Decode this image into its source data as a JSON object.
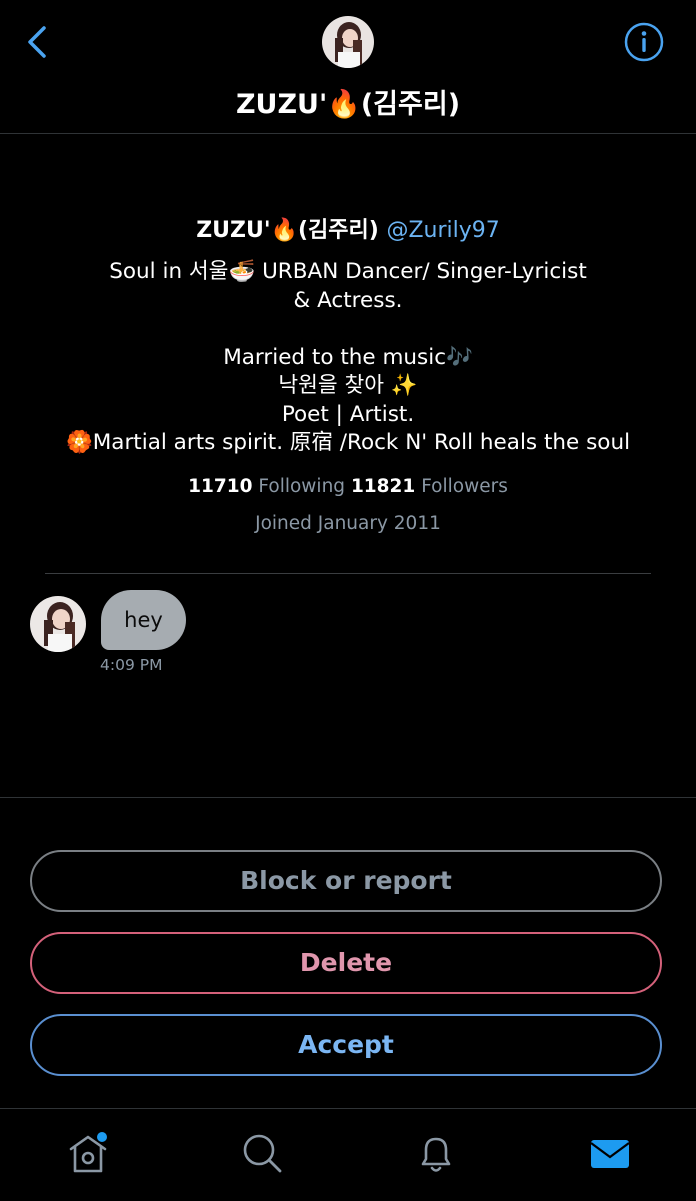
{
  "header": {
    "title": "ZUZU'🔥(김주리)",
    "icons": {
      "back": "chevron-left-icon",
      "info": "info-icon",
      "avatar": "profile-photo"
    }
  },
  "profile": {
    "name": "ZUZU'🔥(김주리)",
    "handle": "@Zurily97",
    "bio": "Soul in 서울🍜 URBAN Dancer/ Singer-Lyricist\n& Actress.\n\nMarried to the music🎶\n낙원을 찾아 ✨\nPoet | Artist.\n🏵️Martial arts spirit. 原宿 /Rock N' Roll heals the soul",
    "following_count": "11710",
    "following_label": "Following",
    "followers_count": "11821",
    "followers_label": "Followers",
    "joined": "Joined January 2011"
  },
  "message": {
    "text": "hey",
    "time": "4:09 PM"
  },
  "actions": {
    "block": "Block or report",
    "delete": "Delete",
    "accept": "Accept"
  },
  "tabs": [
    "home-icon",
    "search-icon",
    "bell-icon",
    "mail-icon"
  ],
  "colors": {
    "accent": "#1d9bf0",
    "link": "#6cb4f3",
    "danger": "#d4617a",
    "muted": "#8b98a5",
    "bubble": "#a6acb1"
  }
}
